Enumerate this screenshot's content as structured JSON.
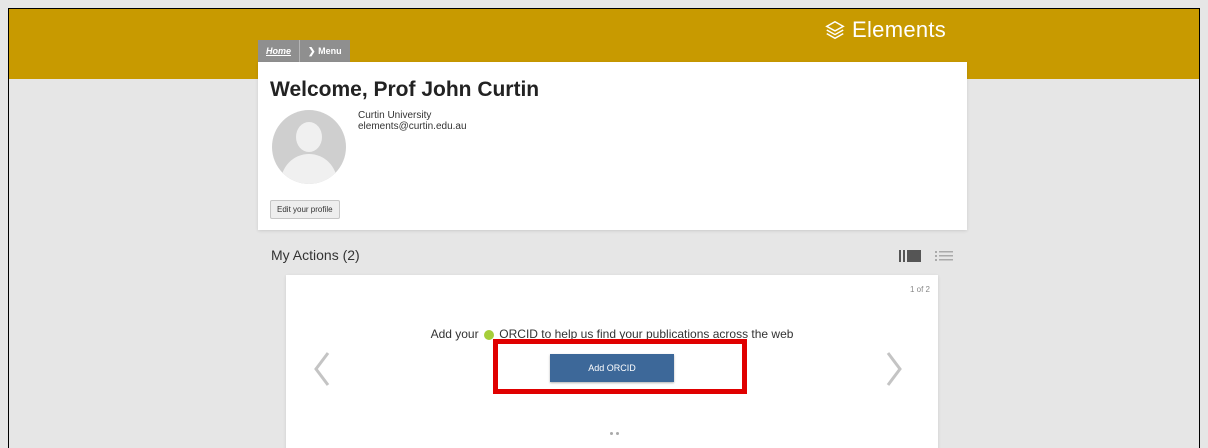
{
  "brand": {
    "name": "Elements",
    "icon": "layers-icon",
    "header_color": "#c89a00"
  },
  "breadcrumb": {
    "home": "Home",
    "menu": "Menu"
  },
  "profile": {
    "welcome": "Welcome, Prof John Curtin",
    "organization": "Curtin University",
    "email": "elements@curtin.edu.au",
    "edit_label": "Edit your profile"
  },
  "actions": {
    "heading": "My Actions (2)",
    "page_count": "1 of 2",
    "message_before": "Add your",
    "message_after": "ORCID to help us find your publications across the web",
    "button_label": "Add ORCID",
    "button_color": "#3d6899",
    "current_page": 1,
    "total_pages": 2
  },
  "annotation": {
    "highlight_color": "#e00000"
  }
}
